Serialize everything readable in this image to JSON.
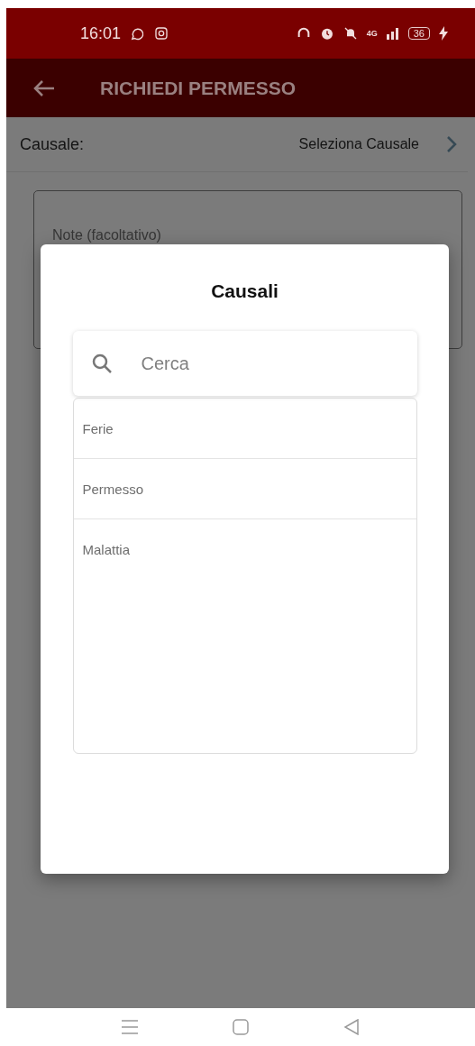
{
  "status_bar": {
    "time": "16:01",
    "network": "4G",
    "battery": "36"
  },
  "app_bar": {
    "title": "RICHIEDI PERMESSO"
  },
  "form": {
    "causale_label": "Causale:",
    "causale_value": "Seleziona Causale",
    "notes": {
      "placeholder": "Note (facoltativo)"
    }
  },
  "dialog": {
    "title": "Causali",
    "search": {
      "placeholder": "Cerca"
    },
    "items": [
      {
        "label": "Ferie",
        "selected": false
      },
      {
        "label": "Permesso",
        "selected": false
      },
      {
        "label": "Malattia",
        "selected": false
      }
    ]
  }
}
